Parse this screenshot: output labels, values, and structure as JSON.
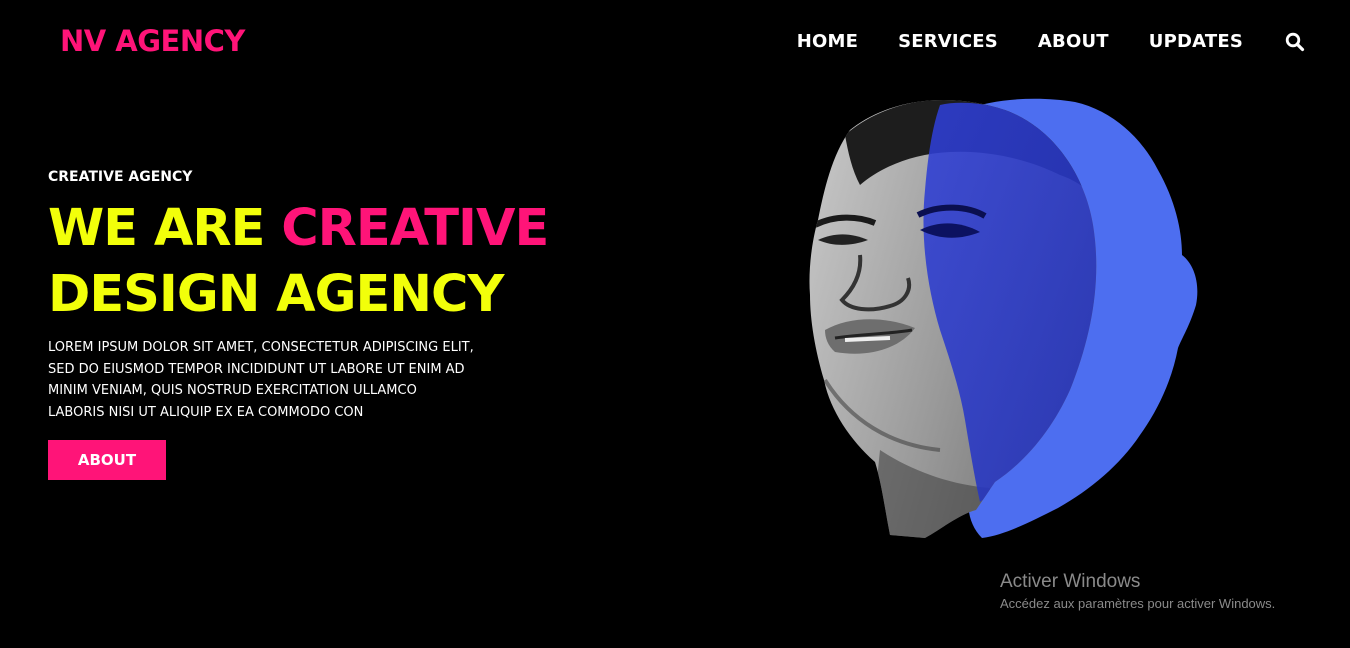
{
  "header": {
    "logo": "NV AGENCY",
    "nav": [
      {
        "label": "HOME"
      },
      {
        "label": "SERVICES"
      },
      {
        "label": "ABOUT"
      },
      {
        "label": "UPDATES"
      }
    ],
    "search_icon": "search-icon"
  },
  "hero": {
    "eyebrow": "CREATIVE AGENCY",
    "headline": {
      "part1": "WE ARE",
      "part2": "CREATIVE",
      "line2": "DESIGN AGENCY"
    },
    "body_lines": [
      "LOREM IPSUM DOLOR SIT AMET, CONSECTETUR ADIPISCING ELIT,",
      "SED DO EIUSMOD TEMPOR INCIDIDUNT UT LABORE UT ENIM AD",
      "MINIM VENIAM, QUIS NOSTRUD EXERCITATION ULLAMCO",
      "LABORIS NISI UT ALIQUIP EX EA COMMODO CON"
    ],
    "button_label": "ABOUT",
    "image": "portrait-face-with-blue-silhouette"
  },
  "watermark": {
    "title": "Activer Windows",
    "subtitle": "Accédez aux paramètres pour activer Windows."
  },
  "colors": {
    "background": "#000000",
    "accent_pink": "#ff1478",
    "accent_yellow": "#f2ff0a",
    "accent_blue": "#4d6ef0",
    "text": "#ffffff"
  }
}
